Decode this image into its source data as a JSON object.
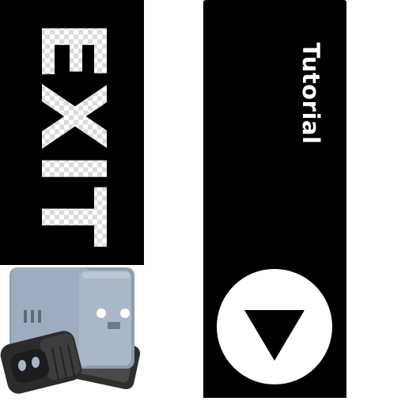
{
  "exit_button": {
    "label": "EXIT"
  },
  "tutorial_button": {
    "label": "Tutorial"
  },
  "scroll_down_button": {
    "icon": "triangle-down-icon"
  },
  "character": {
    "icon": "robot-character-icon"
  },
  "colors": {
    "panel_background": "#000000",
    "text": "#ffffff",
    "page_background": "#ffffff",
    "robot_body": "#a8b6c8",
    "robot_dark": "#3a3a3a"
  }
}
